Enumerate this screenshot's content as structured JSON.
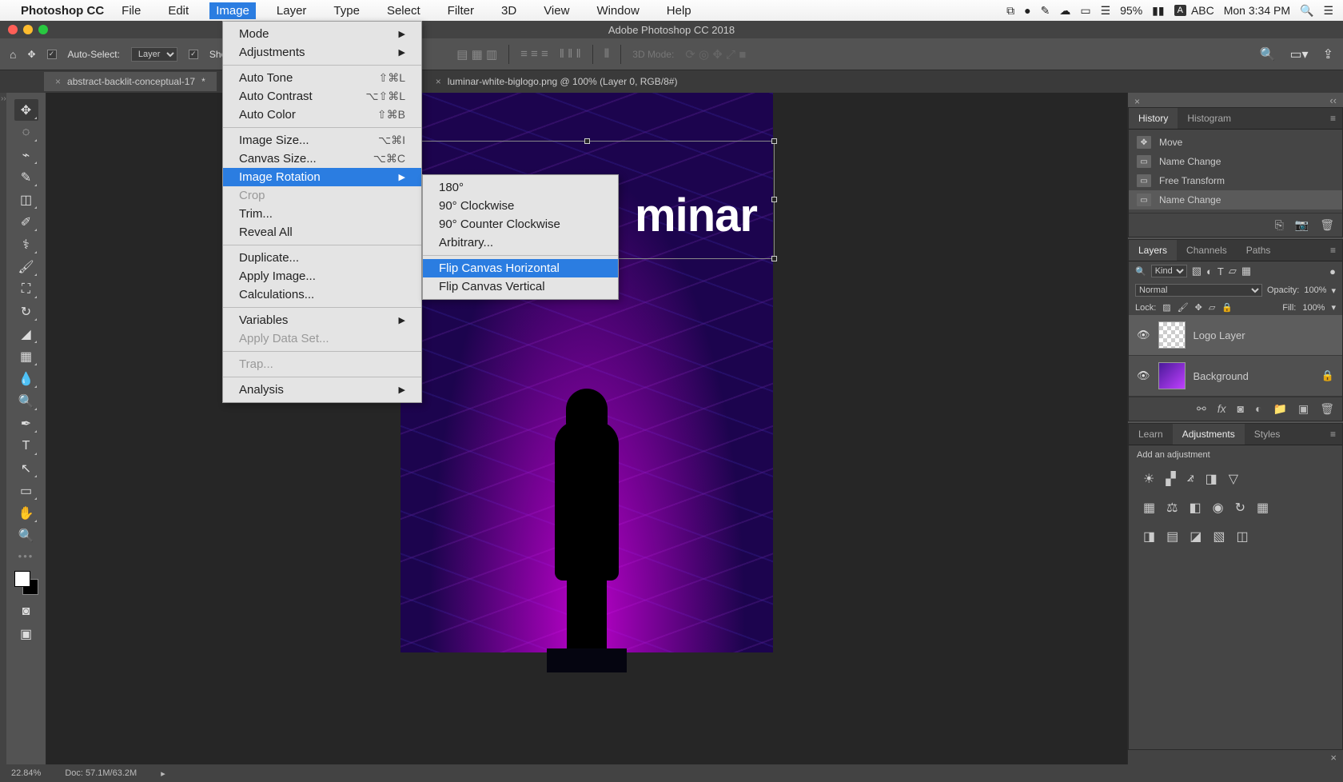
{
  "mac": {
    "appName": "Photoshop CC",
    "menus": [
      "File",
      "Edit",
      "Image",
      "Layer",
      "Type",
      "Select",
      "Filter",
      "3D",
      "View",
      "Window",
      "Help"
    ],
    "activeMenu": "Image",
    "battery": "95%",
    "ime": "ABC",
    "clock": "Mon 3:34 PM"
  },
  "window": {
    "title": "Adobe Photoshop CC 2018"
  },
  "options": {
    "autoSelect": "Auto-Select:",
    "layerDropdown": "Layer",
    "showLabel": "Sho",
    "mode3d": "3D Mode:"
  },
  "tabs": [
    {
      "label": "abstract-backlit-conceptual-17",
      "modified": true,
      "active": true
    },
    {
      "label": "luminar-white-biglogo.png @ 100% (Layer 0, RGB/8#)",
      "modified": false,
      "active": false
    }
  ],
  "canvas": {
    "logoText": "minar"
  },
  "imageMenu": {
    "items": [
      {
        "label": "Mode",
        "submenu": true
      },
      {
        "label": "Adjustments",
        "submenu": true
      },
      null,
      {
        "label": "Auto Tone",
        "shortcut": "⇧⌘L"
      },
      {
        "label": "Auto Contrast",
        "shortcut": "⌥⇧⌘L"
      },
      {
        "label": "Auto Color",
        "shortcut": "⇧⌘B"
      },
      null,
      {
        "label": "Image Size...",
        "shortcut": "⌥⌘I"
      },
      {
        "label": "Canvas Size...",
        "shortcut": "⌥⌘C"
      },
      {
        "label": "Image Rotation",
        "submenu": true,
        "highlighted": true
      },
      {
        "label": "Crop",
        "disabled": true
      },
      {
        "label": "Trim..."
      },
      {
        "label": "Reveal All"
      },
      null,
      {
        "label": "Duplicate..."
      },
      {
        "label": "Apply Image..."
      },
      {
        "label": "Calculations..."
      },
      null,
      {
        "label": "Variables",
        "submenu": true
      },
      {
        "label": "Apply Data Set...",
        "disabled": true
      },
      null,
      {
        "label": "Trap...",
        "disabled": true
      },
      null,
      {
        "label": "Analysis",
        "submenu": true
      }
    ]
  },
  "rotationSubmenu": {
    "items": [
      {
        "label": "180°"
      },
      {
        "label": "90° Clockwise"
      },
      {
        "label": "90° Counter Clockwise"
      },
      {
        "label": "Arbitrary..."
      },
      null,
      {
        "label": "Flip Canvas Horizontal",
        "highlighted": true
      },
      {
        "label": "Flip Canvas Vertical"
      }
    ]
  },
  "panels": {
    "historyTab": "History",
    "histogramTab": "Histogram",
    "history": [
      {
        "label": "Move",
        "icon": "✥"
      },
      {
        "label": "Name Change",
        "icon": "▭"
      },
      {
        "label": "Free Transform",
        "icon": "▭"
      },
      {
        "label": "Name Change",
        "icon": "▭",
        "selected": true
      }
    ],
    "layersTab": "Layers",
    "channelsTab": "Channels",
    "pathsTab": "Paths",
    "kind": "Kind",
    "blend": "Normal",
    "opacityLabel": "Opacity:",
    "opacity": "100%",
    "lockLabel": "Lock:",
    "fillLabel": "Fill:",
    "fill": "100%",
    "layers": [
      {
        "name": "Logo Layer",
        "selected": true,
        "locked": false,
        "thumb": "logo"
      },
      {
        "name": "Background",
        "selected": false,
        "locked": true,
        "thumb": "bg"
      }
    ],
    "learnTab": "Learn",
    "adjTab": "Adjustments",
    "stylesTab": "Styles",
    "addAdj": "Add an adjustment"
  },
  "status": {
    "zoom": "22.84%",
    "doc": "Doc: 57.1M/63.2M"
  }
}
